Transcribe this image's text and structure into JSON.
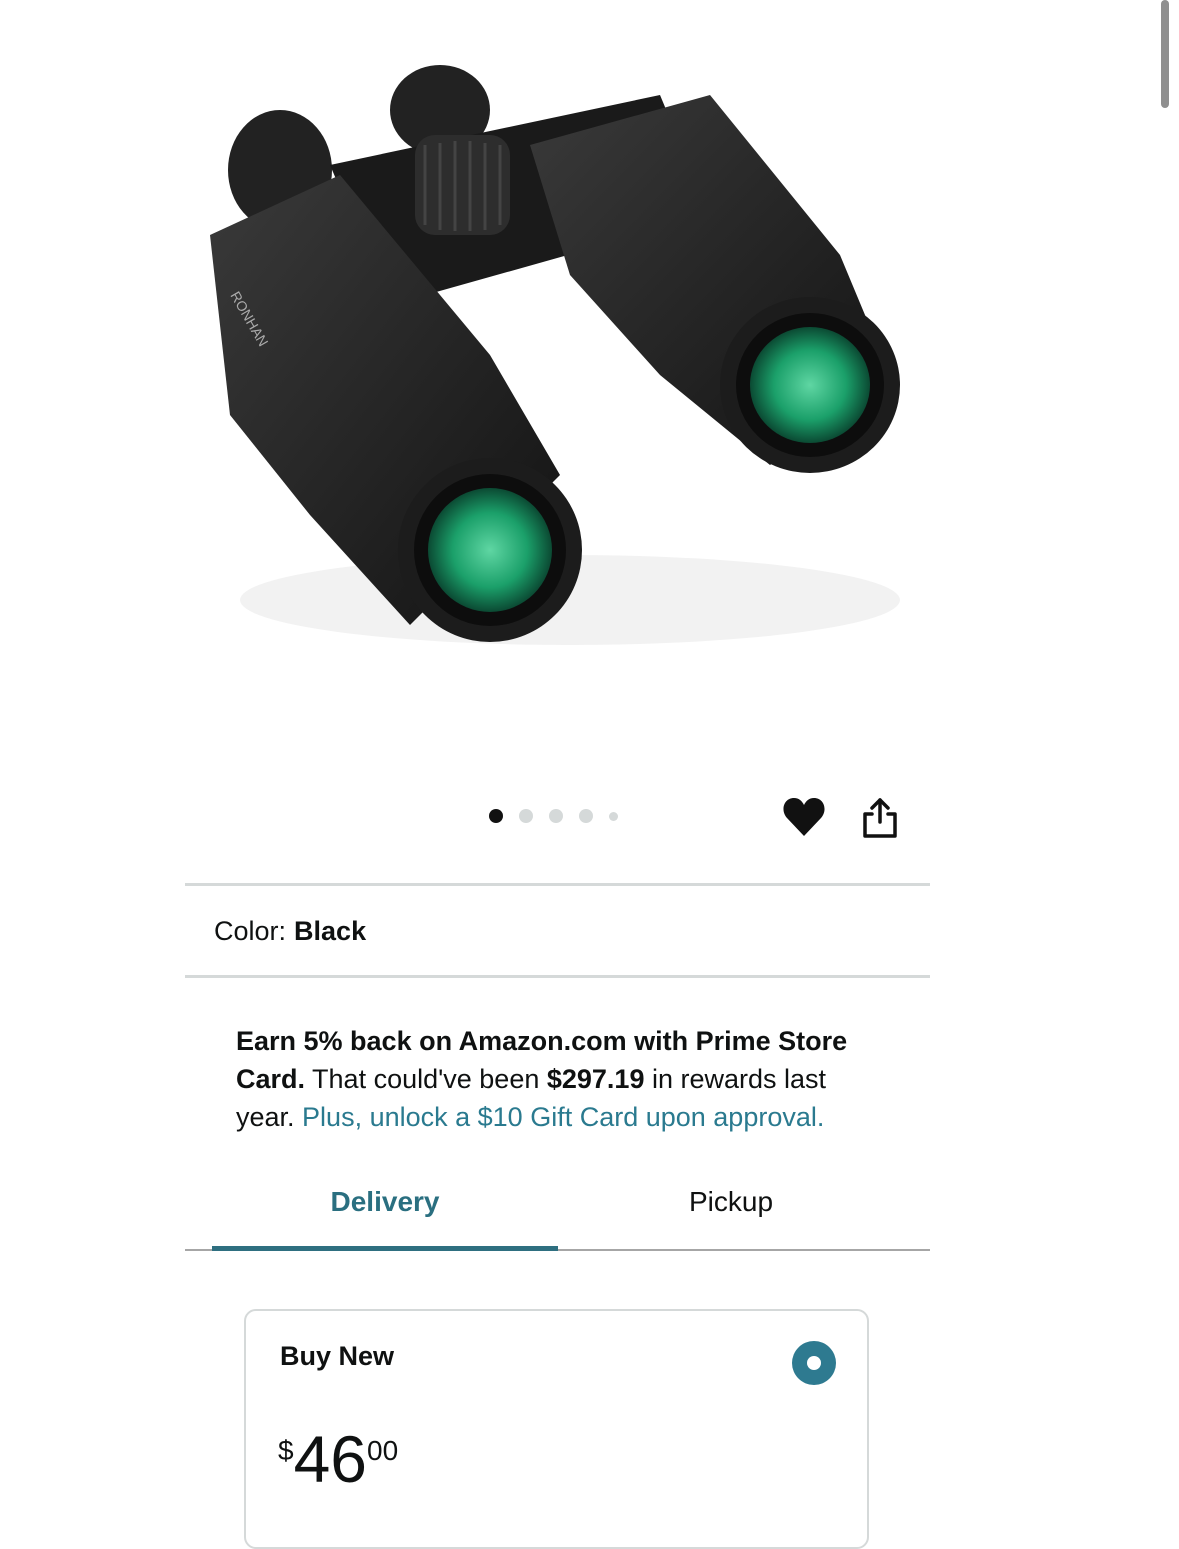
{
  "product": {
    "image_icon": "binoculars-image",
    "image_brand_text": "RONHAN",
    "carousel": {
      "total": 5,
      "active_index": 0
    },
    "actions": {
      "wishlist_icon": "heart-icon",
      "share_icon": "share-icon"
    }
  },
  "color": {
    "label": "Color:",
    "value": "Black"
  },
  "promo": {
    "bold_text": "Earn 5% back on Amazon.com with Prime Store Card.",
    "middle_text": " That could've been ",
    "amount": "$297.19",
    "after_amount": " in rewards last year. ",
    "link_text": "Plus, unlock a $10 Gift Card upon approval."
  },
  "tabs": [
    {
      "label": "Delivery",
      "active": true
    },
    {
      "label": "Pickup",
      "active": false
    }
  ],
  "buy_option": {
    "title": "Buy New",
    "selected": true,
    "price": {
      "symbol": "$",
      "whole": "46",
      "fraction": "00"
    }
  },
  "colors": {
    "accent": "#2a7a8f",
    "text": "#0f1111",
    "divider": "#d5d9d9"
  }
}
